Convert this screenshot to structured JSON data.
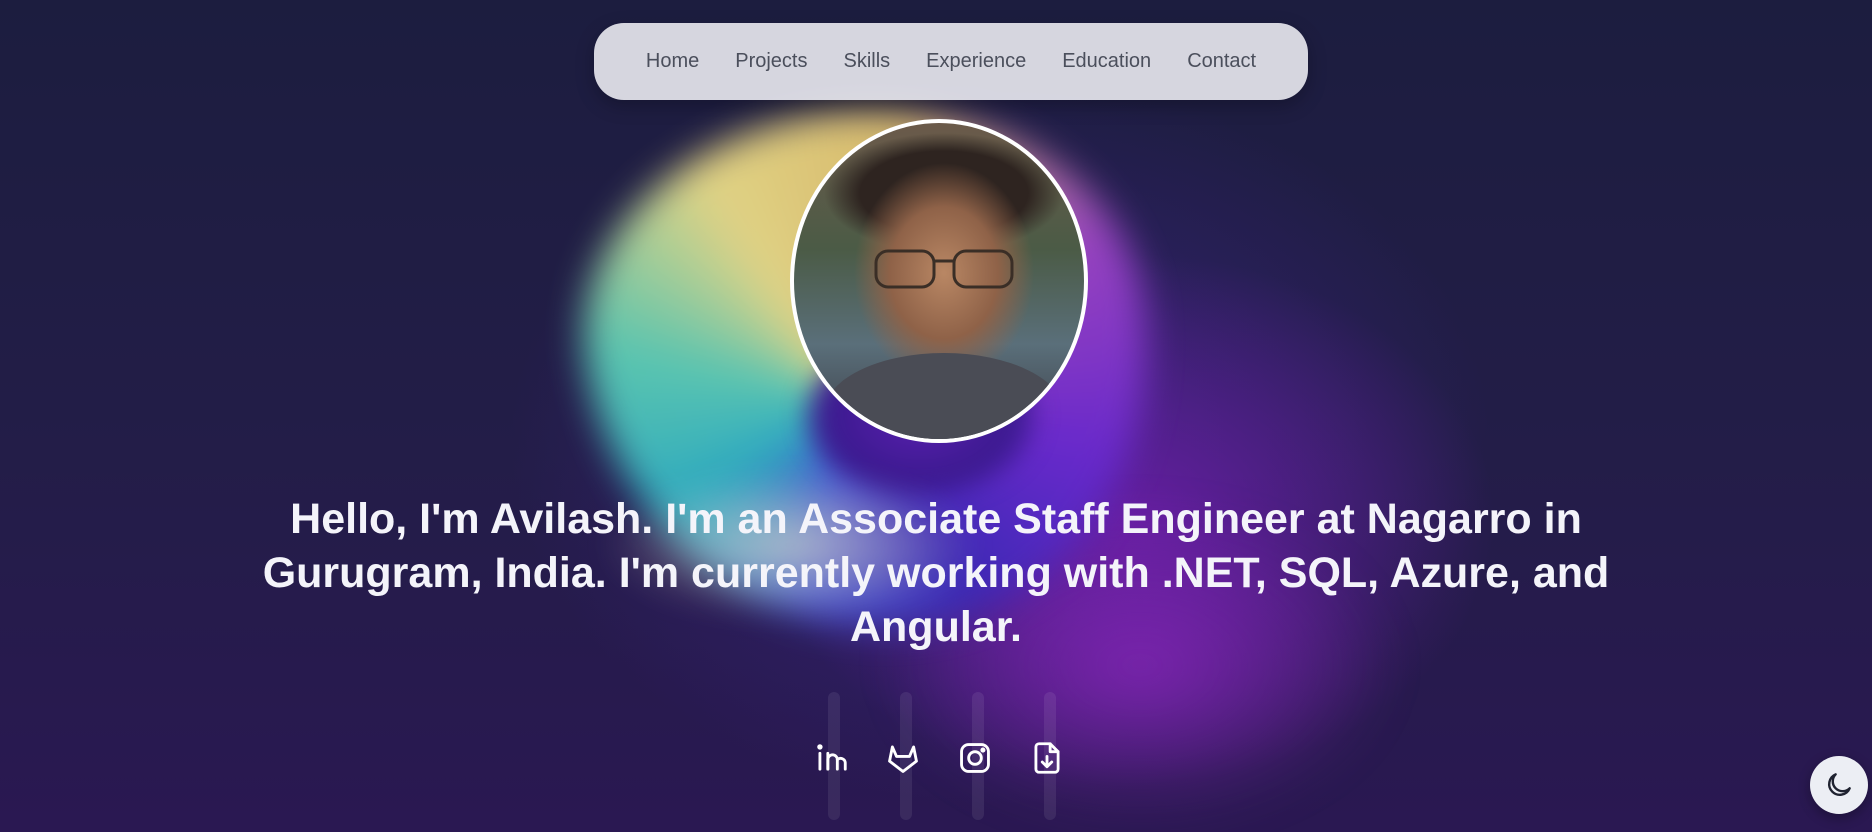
{
  "nav": {
    "items": [
      {
        "label": "Home"
      },
      {
        "label": "Projects"
      },
      {
        "label": "Skills"
      },
      {
        "label": "Experience"
      },
      {
        "label": "Education"
      },
      {
        "label": "Contact"
      }
    ]
  },
  "hero": {
    "headline": "Hello, I'm Avilash. I'm an Associate Staff Engineer at Nagarro in Gurugram, India. I'm currently working with .NET, SQL, Azure, and Angular."
  },
  "socials": [
    {
      "icon": "linkedin-icon"
    },
    {
      "icon": "gitlab-icon"
    },
    {
      "icon": "instagram-icon"
    },
    {
      "icon": "download-resume-icon"
    }
  ],
  "theme_toggle": {
    "icon": "moon-icon"
  },
  "colors": {
    "background": "#1d1d3f",
    "nav_bg": "#e4e4ec",
    "nav_text": "#4b4f5c",
    "headline_text": "#f4f4fa"
  }
}
